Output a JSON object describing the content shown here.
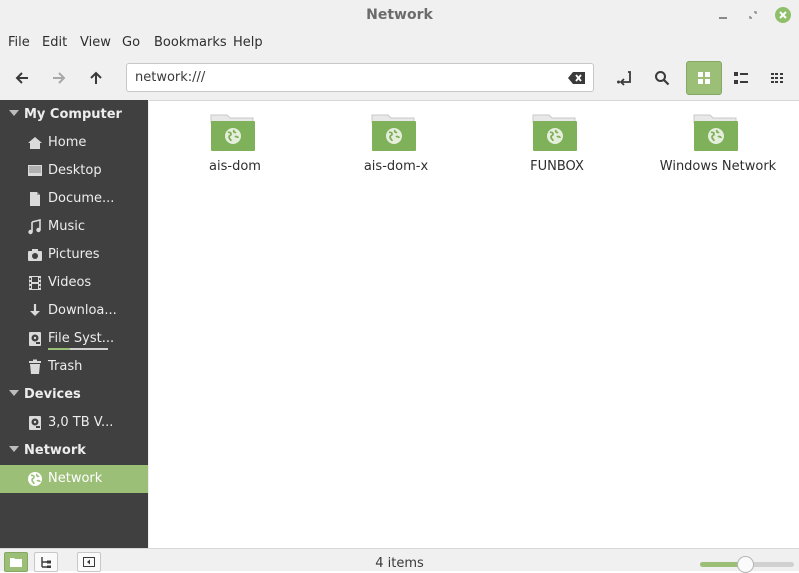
{
  "window": {
    "title": "Network"
  },
  "menu": [
    "File",
    "Edit",
    "View",
    "Go",
    "Bookmarks",
    "Help"
  ],
  "location": {
    "value": "network:///"
  },
  "sidebar": {
    "sections": [
      {
        "label": "My Computer"
      },
      {
        "label": "Devices"
      },
      {
        "label": "Network"
      }
    ],
    "items": [
      {
        "label": "Home",
        "icon": "home-icon"
      },
      {
        "label": "Desktop",
        "icon": "desktop-icon"
      },
      {
        "label": "Docume...",
        "icon": "document-icon"
      },
      {
        "label": "Music",
        "icon": "music-icon"
      },
      {
        "label": "Pictures",
        "icon": "camera-icon"
      },
      {
        "label": "Videos",
        "icon": "film-icon"
      },
      {
        "label": "Downloa...",
        "icon": "download-icon"
      },
      {
        "label": "File Syst...",
        "icon": "drive-icon",
        "usage_fraction": 0.36
      },
      {
        "label": "Trash",
        "icon": "trash-icon"
      },
      {
        "label": "3,0 TB V...",
        "icon": "drive-icon"
      },
      {
        "label": "Network",
        "icon": "globe-icon",
        "selected": true
      }
    ]
  },
  "files": [
    {
      "name": "ais-dom",
      "icon": "network-folder-icon"
    },
    {
      "name": "ais-dom-x",
      "icon": "network-folder-icon"
    },
    {
      "name": "FUNBOX",
      "icon": "network-folder-icon"
    },
    {
      "name": "Windows Network",
      "icon": "network-folder-icon"
    }
  ],
  "status": {
    "text": "4 items",
    "zoom_fraction": 0.48
  },
  "colors": {
    "accent": "#9cbf78",
    "sidebar_bg": "#404040",
    "folder": "#7fb05a"
  }
}
